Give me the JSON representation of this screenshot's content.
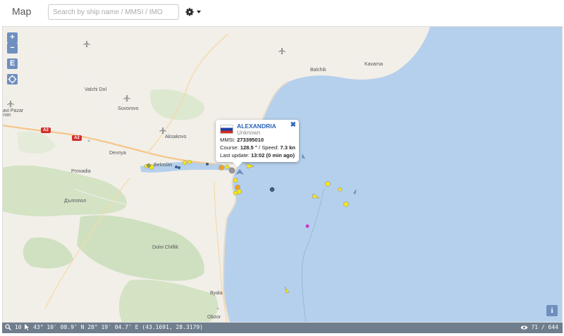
{
  "header": {
    "title": "Map",
    "search_placeholder": "Search by ship name / MMSI / IMO"
  },
  "controls": {
    "zoom_in": "+",
    "zoom_out": "−",
    "e_button": "E",
    "info": "i"
  },
  "places": {
    "valchi_dol": "Valchi Dol",
    "suvorovo": "Suvorovo",
    "avi_pazar": "avi Pazar",
    "aksakovo": "Aksakovo",
    "devnya": "Devnya",
    "provadia": "Provadia",
    "dalgopol": "Дългопол",
    "dolni_chiflik": "Dolni Chiflik",
    "byala": "Byala",
    "obzor": "Obzor",
    "balchik": "Balchik",
    "kavarna": "Kavarna",
    "beloslav": "Beloslav",
    "nan": "nan",
    "road_a2": "A2"
  },
  "popup": {
    "ship_name": "ALEXANDRIA",
    "ship_type": "Unknown",
    "mmsi_label": "MMSI:",
    "mmsi": "273395010",
    "course_label": "Course:",
    "course": "128.5 °",
    "speed_label": "/ Speed:",
    "speed": "7.3 kn",
    "update_label": "Last update:",
    "update": "13:02 (0 min ago)",
    "close": "✖"
  },
  "status": {
    "zoom": "10",
    "coords": "43° 10′ 08.9″ N 28° 19′ 04.7″ E (43.1691, 28.3179)",
    "count": "71 / 644"
  },
  "colors": {
    "water": "#b5d0ec",
    "land": "#f2efe9",
    "control": "#6f8fbf",
    "ship_yellow": "#f5e51e",
    "ship_blue": "#3a5f8f",
    "ship_magenta": "#c83cc8"
  }
}
